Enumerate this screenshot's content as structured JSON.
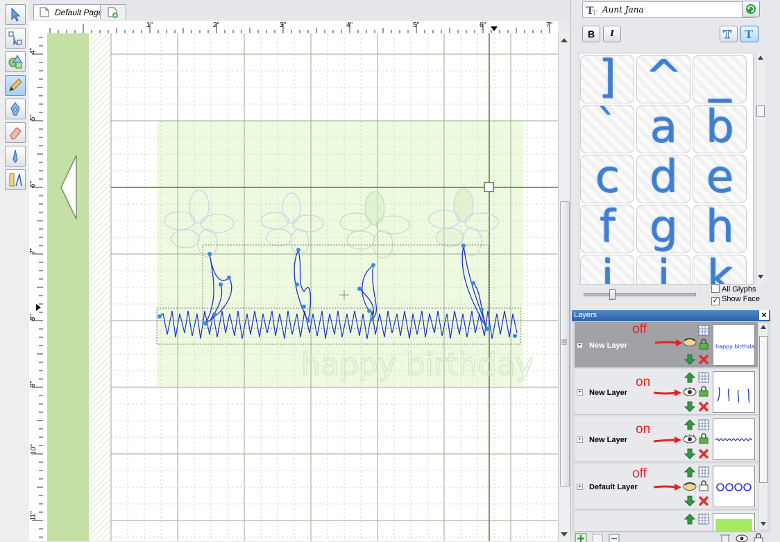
{
  "document_tab": {
    "label": "Default Page"
  },
  "ruler": {
    "horizontal_labels": [
      "1\"",
      "2\"",
      "3\"",
      "4\"",
      "5\"",
      "6\"",
      "7\""
    ],
    "vertical_labels": [
      "4\"",
      "5\"",
      "6\"",
      "7\"",
      "8\"",
      "9\"",
      "10\"",
      "11\""
    ]
  },
  "canvas": {
    "watermark_text": "happy birthday"
  },
  "font_panel": {
    "font_name": "Aunt Jana",
    "bold_label": "B",
    "italic_label": "I"
  },
  "glyph_grid": {
    "glyphs": [
      "]",
      "^",
      "_",
      "`",
      "a",
      "b",
      "c",
      "d",
      "e",
      "f",
      "g",
      "h",
      "i",
      "j",
      "k"
    ]
  },
  "glyph_options": {
    "all_glyphs_label": "All Glyphs",
    "all_glyphs_checked": false,
    "show_face_label": "Show Face",
    "show_face_checked": true
  },
  "layers_panel": {
    "title": "Layers",
    "close_label": "×",
    "layers": [
      {
        "name": "New Layer",
        "annotation": "off",
        "visible": false,
        "thumb": "happy birthday"
      },
      {
        "name": "New Layer",
        "annotation": "on",
        "visible": true,
        "thumb": "stems"
      },
      {
        "name": "New Layer",
        "annotation": "on",
        "visible": true,
        "thumb": "grass"
      },
      {
        "name": "Default Layer",
        "annotation": "off",
        "visible": false,
        "thumb": "flowers"
      },
      {
        "name": "",
        "annotation": "",
        "visible": true,
        "thumb": "green"
      }
    ]
  },
  "colors": {
    "accent": "#3e7fd1",
    "annotation": "#e52222",
    "sidebar_green": "#c5e0a5",
    "stroke_blue": "#1f2fd0"
  }
}
